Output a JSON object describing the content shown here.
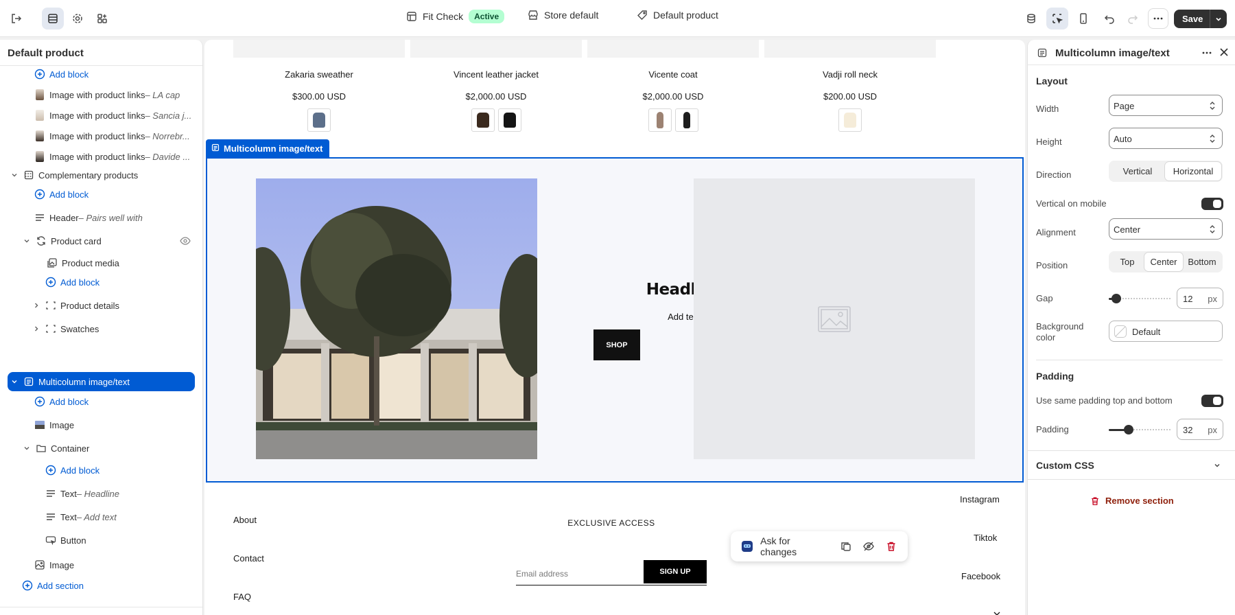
{
  "topbar": {
    "theme_name": "Fit Check",
    "theme_status": "Active",
    "store": "Store default",
    "template": "Default product",
    "save_label": "Save"
  },
  "sidebar": {
    "title": "Default product",
    "rows": [
      {
        "label": "Add block",
        "type": "add"
      },
      {
        "label": "Image with product links",
        "sub": " – LA cap"
      },
      {
        "label": "Image with product links",
        "sub": " – Sancia j..."
      },
      {
        "label": "Image with product links",
        "sub": " – Norrebr..."
      },
      {
        "label": "Image with product links",
        "sub": " – Davide ..."
      },
      {
        "label": "Complementary products"
      },
      {
        "label": "Add block",
        "type": "add"
      },
      {
        "label": "Header",
        "sub": " – Pairs well with"
      },
      {
        "label": "Product card"
      },
      {
        "label": "Product media"
      },
      {
        "label": "Add block",
        "type": "add"
      },
      {
        "label": "Product details"
      },
      {
        "label": "Swatches"
      },
      {
        "label": "Multicolumn image/text"
      },
      {
        "label": "Add block",
        "type": "add"
      },
      {
        "label": "Image"
      },
      {
        "label": "Container"
      },
      {
        "label": "Add block",
        "type": "add"
      },
      {
        "label": "Text",
        "sub": " – Headline"
      },
      {
        "label": "Text",
        "sub": " – Add text"
      },
      {
        "label": "Button"
      },
      {
        "label": "Image"
      },
      {
        "label": "Add section",
        "type": "add"
      }
    ]
  },
  "canvas": {
    "products": [
      {
        "name": "Zakaria sweather",
        "price": "$300.00 USD"
      },
      {
        "name": "Vincent leather jacket",
        "price": "$2,000.00 USD"
      },
      {
        "name": "Vicente coat",
        "price": "$2,000.00 USD"
      },
      {
        "name": "Vadji roll neck",
        "price": "$200.00 USD"
      }
    ],
    "section_label": "Multicolumn image/text",
    "headline": "Headline",
    "add_text": "Add text",
    "button_label": "SHOP",
    "footer": {
      "about": "About",
      "contact": "Contact",
      "faq": "FAQ",
      "instagram": "Instagram",
      "tiktok": "Tiktok",
      "facebook": "Facebook",
      "exclusive": "EXCLUSIVE ACCESS",
      "email_placeholder": "Email address",
      "signup": "SIGN UP"
    },
    "ask_label": "Ask for changes"
  },
  "panel": {
    "title": "Multicolumn image/text",
    "layout_heading": "Layout",
    "width_label": "Width",
    "width_value": "Page",
    "height_label": "Height",
    "height_value": "Auto",
    "direction_label": "Direction",
    "direction_options": [
      "Vertical",
      "Horizontal"
    ],
    "direction_selected": "Horizontal",
    "vertical_mobile_label": "Vertical on mobile",
    "vertical_mobile_on": true,
    "alignment_label": "Alignment",
    "alignment_value": "Center",
    "position_label": "Position",
    "position_options": [
      "Top",
      "Center",
      "Bottom"
    ],
    "position_selected": "Center",
    "gap_label": "Gap",
    "gap_value": "12",
    "gap_unit": "px",
    "bg_label": "Background color",
    "bg_value": "Default",
    "padding_heading": "Padding",
    "same_padding_label": "Use same padding top and bottom",
    "same_padding_on": true,
    "padding_label": "Padding",
    "padding_value": "32",
    "padding_unit": "px",
    "custom_css_label": "Custom CSS",
    "remove_label": "Remove section"
  },
  "colors": {
    "accent": "#005bd3",
    "active_badge": "#b4fed2",
    "critical": "#8e1f0b"
  }
}
